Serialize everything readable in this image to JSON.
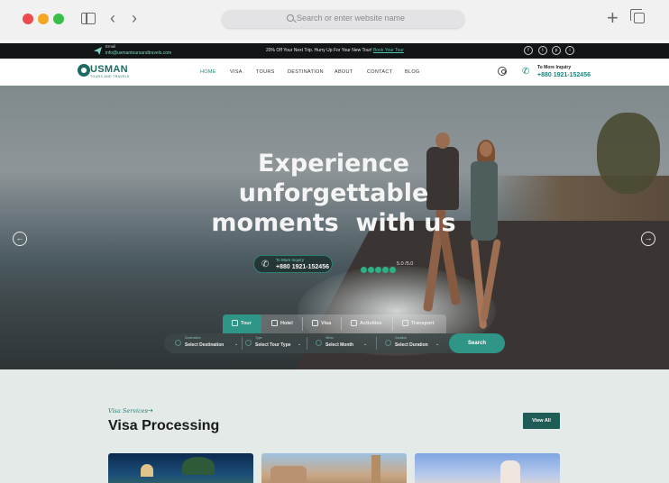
{
  "browser": {
    "url_placeholder": "Search or enter website name"
  },
  "topbar": {
    "email_label": "Email",
    "email": "info@usmantoursandtravels.com",
    "offer_text": "20% Off Your Next Trip. Hurry Up For Your New Tour!",
    "offer_link": "Book Your Tour",
    "social": [
      "f",
      "t",
      "p",
      "i"
    ]
  },
  "nav": {
    "logo": "USMAN",
    "logo_sub": "TOURS AND TRAVELS",
    "links": [
      "HOME",
      "VISA",
      "TOURS",
      "DESTINATION",
      "ABOUT",
      "CONTACT",
      "BLOG"
    ],
    "active": "HOME",
    "inquiry_label": "To More Inquiry",
    "inquiry_phone": "+880 1921-152456"
  },
  "hero": {
    "title_lines": [
      "Experience",
      "unforgettable",
      "moments  with us"
    ],
    "pill_label": "To More Inquiry",
    "pill_phone": "+880 1921-152456",
    "rating": "5.0 /5.0",
    "stars": 5
  },
  "search": {
    "tabs": [
      "Tour",
      "Hotel",
      "Visa",
      "Activities",
      "Transport"
    ],
    "active_tab": "Tour",
    "fields": [
      {
        "label": "Destination",
        "value": "Select Destination"
      },
      {
        "label": "Type",
        "value": "Select Tour Type"
      },
      {
        "label": "When",
        "value": "Select Month"
      },
      {
        "label": "Duration",
        "value": "Select Duration"
      }
    ],
    "button": "Search"
  },
  "section": {
    "eyebrow": "Visa Services",
    "title": "Visa Processing",
    "view_all": "View All"
  },
  "colors": {
    "accent": "#2e9587",
    "dark_teal": "#1f5c55",
    "topbar": "#121515"
  }
}
